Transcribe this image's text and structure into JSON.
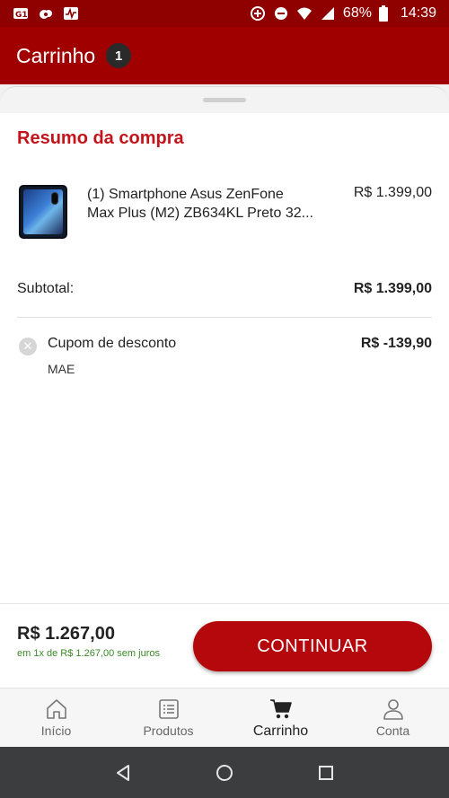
{
  "status_bar": {
    "battery": "68%",
    "time": "14:39",
    "icons": [
      "sim-icon",
      "cloud-icon",
      "activity-icon",
      "data-saver-icon",
      "do-not-disturb-icon",
      "wifi-icon",
      "signal-icon",
      "battery-icon"
    ]
  },
  "header": {
    "title": "Carrinho",
    "badge_count": "1",
    "background": "#a10000"
  },
  "summary": {
    "title": "Resumo da compra",
    "title_color": "#c4141b",
    "product": {
      "line1": "(1) Smartphone Asus ZenFone",
      "line2": "Max Plus (M2) ZB634KL Preto 32...",
      "price": "R$ 1.399,00"
    },
    "subtotal_label": "Subtotal:",
    "subtotal_value": "R$ 1.399,00",
    "coupon": {
      "label": "Cupom de desconto",
      "code": "MAE",
      "value": "R$ -139,90"
    }
  },
  "footer": {
    "total": "R$ 1.267,00",
    "installments": "em 1x de R$ 1.267,00 sem juros",
    "continue_label": "CONTINUAR",
    "accent": "#b5080c",
    "installments_color": "#3a8a26"
  },
  "bottom_nav": {
    "items": [
      {
        "label": "Início",
        "icon": "home-icon"
      },
      {
        "label": "Produtos",
        "icon": "list-icon"
      },
      {
        "label": "Carrinho",
        "icon": "cart-icon",
        "active": true
      },
      {
        "label": "Conta",
        "icon": "user-icon"
      }
    ]
  },
  "system_nav": {
    "icons": [
      "back-icon",
      "home-circle-icon",
      "recents-icon"
    ]
  }
}
